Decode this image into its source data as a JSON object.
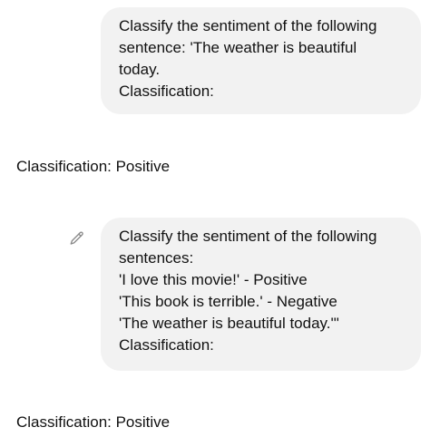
{
  "conversation": {
    "messages": [
      {
        "role": "user",
        "lines": [
          "Classify the sentiment of the following",
          "sentence: 'The weather is beautiful",
          "today.",
          "Classification:"
        ]
      },
      {
        "role": "assistant",
        "text": "Classification: Positive"
      },
      {
        "role": "user",
        "edit_icon": "pencil-icon",
        "lines": [
          "Classify the sentiment of the following",
          "sentences:",
          "'I love this movie!' - Positive",
          "'This book is terrible.' - Negative",
          "'The weather is beautiful today.'\"",
          "Classification:"
        ]
      },
      {
        "role": "assistant",
        "text": "Classification: Positive"
      }
    ]
  },
  "colors": {
    "bubble_background": "#f2f2f2",
    "text": "#111111",
    "icon": "#8a8a8a"
  }
}
